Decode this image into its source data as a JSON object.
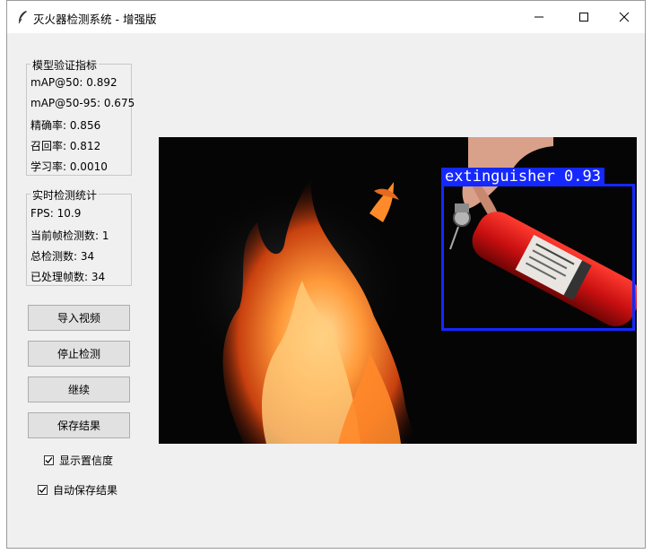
{
  "window": {
    "title": "灭火器检测系统 - 增强版",
    "controls": {
      "minimize_icon": "minimize-icon",
      "maximize_icon": "maximize-icon",
      "close_icon": "close-icon"
    }
  },
  "metrics": {
    "legend": "模型验证指标",
    "lines": [
      "mAP@50: 0.892",
      "mAP@50-95: 0.675",
      "精确率: 0.856",
      "召回率: 0.812",
      "学习率: 0.0010"
    ]
  },
  "stats": {
    "legend": "实时检测统计",
    "lines": [
      "FPS: 10.9",
      "当前帧检测数: 1",
      "总检测数: 34",
      "已处理帧数: 34"
    ]
  },
  "buttons": {
    "import_video": "导入视频",
    "stop_detect": "停止检测",
    "continue": "继续",
    "save_result": "保存结果"
  },
  "options": {
    "show_confidence": {
      "label": "显示置信度",
      "checked": true
    },
    "auto_save": {
      "label": "自动保存结果",
      "checked": true
    }
  },
  "video": {
    "detection": {
      "label": "extinguisher 0.93",
      "color": "#1428ff"
    }
  }
}
